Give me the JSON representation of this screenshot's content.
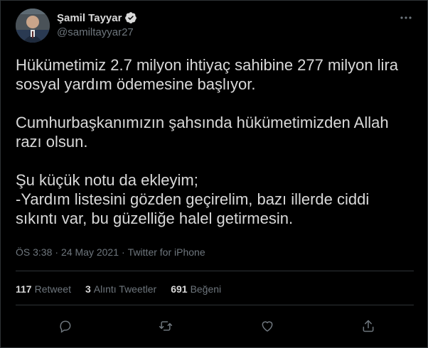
{
  "tweet": {
    "author": {
      "display_name": "Şamil Tayyar",
      "handle": "@samiltayyar27",
      "verified": true
    },
    "text": "Hükümetimiz 2.7 milyon ihtiyaç sahibine 277 milyon lira sosyal yardım ödemesine başlıyor.\n\nCumhurbaşkanımızın şahsında hükümetimizden Allah razı olsun.\n\nŞu küçük notu da ekleyim;\n-Yardım listesini gözden geçirelim, bazı illerde ciddi sıkıntı var, bu güzelliğe halel getirmesin.",
    "meta": {
      "time": "ÖS 3:38",
      "separator": "·",
      "date": "24 May 2021",
      "source": "Twitter for iPhone"
    },
    "stats": {
      "retweets_count": "117",
      "retweets_label": "Retweet",
      "quotes_count": "3",
      "quotes_label": "Alıntı Tweetler",
      "likes_count": "691",
      "likes_label": "Beğeni"
    }
  },
  "icons": {
    "verified": "verified-badge-icon",
    "more": "more-dots-icon",
    "reply": "reply-icon",
    "retweet": "retweet-icon",
    "like": "heart-icon",
    "share": "share-icon"
  },
  "colors": {
    "background": "#000000",
    "text": "#d9d9d9",
    "secondary_text": "#6e767d",
    "border": "#2f3336",
    "verified_badge": "#d9d9d9"
  }
}
